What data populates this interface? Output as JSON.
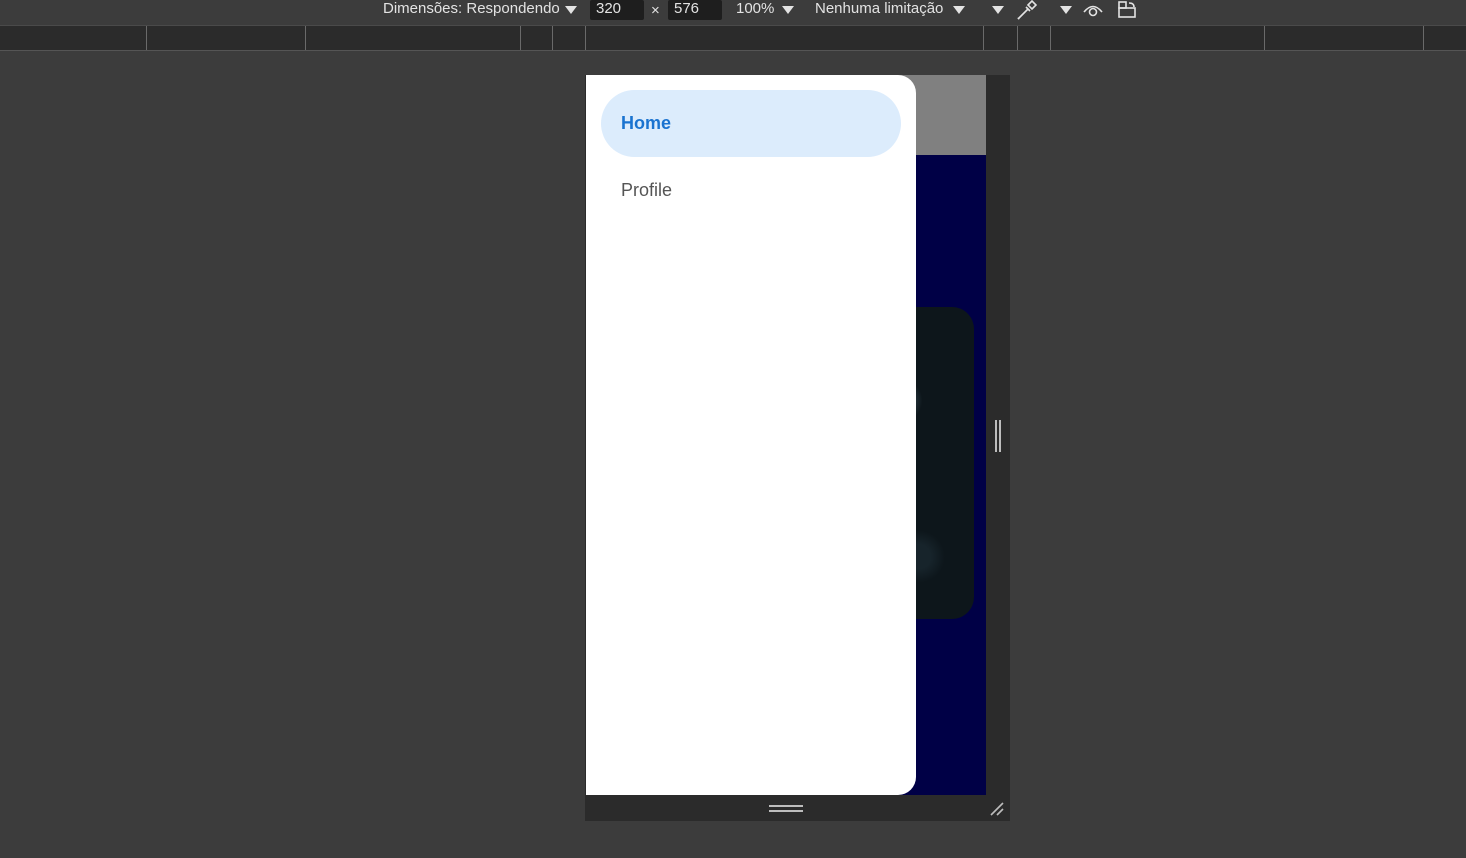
{
  "toolbar": {
    "dimensions_label": "Dimensões: Respondendo",
    "width_value": "320",
    "times": "×",
    "height_value": "576",
    "zoom": "100%",
    "throttling": "Nenhuma limitação",
    "icons": [
      "chevron-down-icon",
      "color-picker-icon",
      "eye-icon",
      "rotate-icon"
    ]
  },
  "drawer": {
    "items": [
      {
        "label": "Home",
        "active": true
      },
      {
        "label": "Profile",
        "active": false
      }
    ]
  },
  "colors": {
    "devtools_bg": "#3c3c3c",
    "page_bg": "#000046",
    "header_bg": "#808080",
    "active_item_bg": "#dcecfc",
    "active_item_text": "#1a73d0"
  }
}
